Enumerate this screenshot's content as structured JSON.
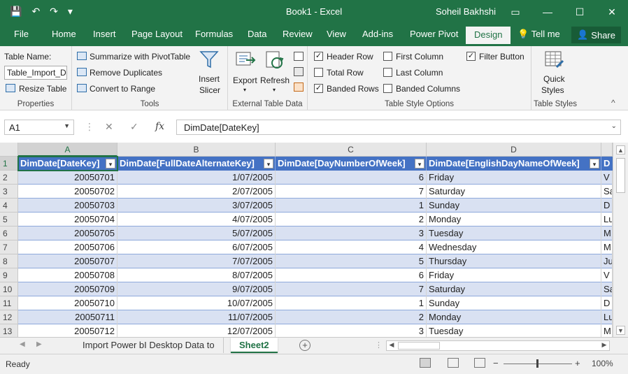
{
  "window": {
    "doc_title": "Book1 - Excel",
    "user": "Soheil Bakhshi",
    "qat": {
      "save_icon": "💾",
      "undo_icon": "↶",
      "redo_icon": "↷",
      "customize_icon": "▾"
    },
    "winbtns": {
      "ribbon_options": "▭",
      "minimize": "—",
      "maximize": "☐",
      "close": "✕"
    }
  },
  "tabs": [
    "File",
    "Home",
    "Insert",
    "Page Layout",
    "Formulas",
    "Data",
    "Review",
    "View",
    "Add-ins",
    "Power Pivot",
    "Design"
  ],
  "active_tab": "Design",
  "tell_me": "Tell me",
  "share": "Share",
  "ribbon": {
    "properties": {
      "label": "Properties",
      "table_name_label": "Table Name:",
      "table_name_value": "Table_Import_Di",
      "resize": "Resize Table"
    },
    "tools": {
      "label": "Tools",
      "summarize": "Summarize with PivotTable",
      "remove_dupes": "Remove Duplicates",
      "convert": "Convert to Range",
      "insert_slicer_1": "Insert",
      "insert_slicer_2": "Slicer"
    },
    "external": {
      "label": "External Table Data",
      "export": "Export",
      "refresh": "Refresh"
    },
    "style_options": {
      "label": "Table Style Options",
      "header_row": "Header Row",
      "total_row": "Total Row",
      "banded_rows": "Banded Rows",
      "first_column": "First Column",
      "last_column": "Last Column",
      "banded_columns": "Banded Columns",
      "filter_button": "Filter Button"
    },
    "table_styles": {
      "label": "Table Styles",
      "quick_1": "Quick",
      "quick_2": "Styles"
    },
    "collapse": "^"
  },
  "formula_bar": {
    "name_box": "A1",
    "cancel": "✕",
    "enter": "✓",
    "fx": "fx",
    "formula": "DimDate[DateKey]"
  },
  "grid": {
    "columns": [
      "A",
      "B",
      "C",
      "D"
    ],
    "headers": [
      "DimDate[DateKey]",
      "DimDate[FullDateAlternateKey]",
      "DimDate[DayNumberOfWeek]",
      "DimDate[EnglishDayNameOfWeek]",
      "D"
    ],
    "filter_icon": "▾",
    "rows": [
      {
        "n": "1"
      },
      {
        "n": "2",
        "a": "20050701",
        "b": "1/07/2005",
        "c": "6",
        "d": "Friday",
        "e": "V"
      },
      {
        "n": "3",
        "a": "20050702",
        "b": "2/07/2005",
        "c": "7",
        "d": "Saturday",
        "e": "Sa"
      },
      {
        "n": "4",
        "a": "20050703",
        "b": "3/07/2005",
        "c": "1",
        "d": "Sunday",
        "e": "D"
      },
      {
        "n": "5",
        "a": "20050704",
        "b": "4/07/2005",
        "c": "2",
        "d": "Monday",
        "e": "Lu"
      },
      {
        "n": "6",
        "a": "20050705",
        "b": "5/07/2005",
        "c": "3",
        "d": "Tuesday",
        "e": "M"
      },
      {
        "n": "7",
        "a": "20050706",
        "b": "6/07/2005",
        "c": "4",
        "d": "Wednesday",
        "e": "M"
      },
      {
        "n": "8",
        "a": "20050707",
        "b": "7/07/2005",
        "c": "5",
        "d": "Thursday",
        "e": "Ju"
      },
      {
        "n": "9",
        "a": "20050708",
        "b": "8/07/2005",
        "c": "6",
        "d": "Friday",
        "e": "V"
      },
      {
        "n": "10",
        "a": "20050709",
        "b": "9/07/2005",
        "c": "7",
        "d": "Saturday",
        "e": "Sa"
      },
      {
        "n": "11",
        "a": "20050710",
        "b": "10/07/2005",
        "c": "1",
        "d": "Sunday",
        "e": "D"
      },
      {
        "n": "12",
        "a": "20050711",
        "b": "11/07/2005",
        "c": "2",
        "d": "Monday",
        "e": "Lu"
      },
      {
        "n": "13",
        "a": "20050712",
        "b": "12/07/2005",
        "c": "3",
        "d": "Tuesday",
        "e": "M"
      }
    ]
  },
  "sheets": {
    "tab1": "Import Power bI Desktop Data to",
    "tab2": "Sheet2",
    "add": "+",
    "nav_prev": "◀",
    "nav_next": "▶"
  },
  "status": {
    "ready": "Ready",
    "zoom_minus": "−",
    "zoom_plus": "+",
    "zoom": "100%"
  },
  "colors": {
    "excel_green": "#217346",
    "table_header": "#4472c4",
    "band": "#d9e1f2"
  }
}
